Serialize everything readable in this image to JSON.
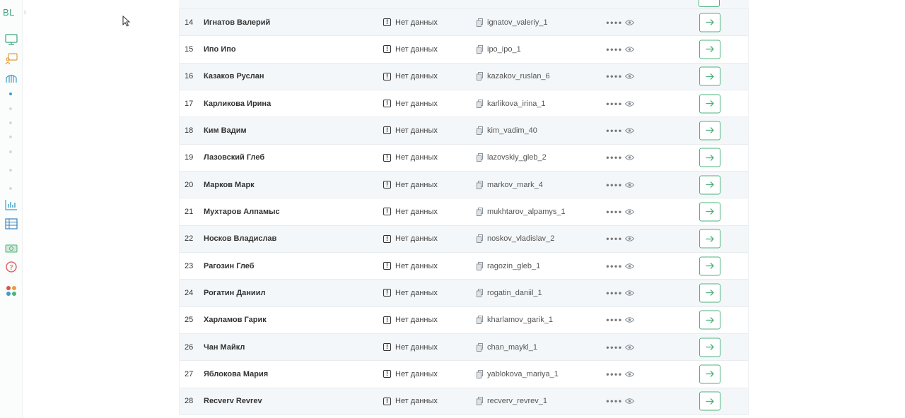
{
  "sidebar": {
    "logo": "BL",
    "icons": [
      "monitor-icon",
      "presentation-icon",
      "structure-icon",
      "chart-icon",
      "table-icon",
      "money-icon",
      "help-icon",
      "apps-icon"
    ],
    "accent": "#3aa57a"
  },
  "table": {
    "status_color": "#333333",
    "rows": [
      {
        "num": "14",
        "name": "Игнатов Валерий",
        "status": "Нет данных",
        "login": "ignatov_valeriy_1",
        "password": "●●●●"
      },
      {
        "num": "15",
        "name": "Ипо Ипо",
        "status": "Нет данных",
        "login": "ipo_ipo_1",
        "password": "●●●●"
      },
      {
        "num": "16",
        "name": "Казаков Руслан",
        "status": "Нет данных",
        "login": "kazakov_ruslan_6",
        "password": "●●●●"
      },
      {
        "num": "17",
        "name": "Карликова Ирина",
        "status": "Нет данных",
        "login": "karlikova_irina_1",
        "password": "●●●●"
      },
      {
        "num": "18",
        "name": "Ким Вадим",
        "status": "Нет данных",
        "login": "kim_vadim_40",
        "password": "●●●●"
      },
      {
        "num": "19",
        "name": "Лазовский Глеб",
        "status": "Нет данных",
        "login": "lazovskiy_gleb_2",
        "password": "●●●●"
      },
      {
        "num": "20",
        "name": "Марков Марк",
        "status": "Нет данных",
        "login": "markov_mark_4",
        "password": "●●●●"
      },
      {
        "num": "21",
        "name": "Мухтаров Алпамыс",
        "status": "Нет данных",
        "login": "mukhtarov_alpamys_1",
        "password": "●●●●"
      },
      {
        "num": "22",
        "name": "Носков Владислав",
        "status": "Нет данных",
        "login": "noskov_vladislav_2",
        "password": "●●●●"
      },
      {
        "num": "23",
        "name": "Рагозин Глеб",
        "status": "Нет данных",
        "login": "ragozin_gleb_1",
        "password": "●●●●"
      },
      {
        "num": "24",
        "name": "Рогатин Даниил",
        "status": "Нет данных",
        "login": "rogatin_daniil_1",
        "password": "●●●●"
      },
      {
        "num": "25",
        "name": "Харламов Гарик",
        "status": "Нет данных",
        "login": "kharlamov_garik_1",
        "password": "●●●●"
      },
      {
        "num": "26",
        "name": "Чан Майкл",
        "status": "Нет данных",
        "login": "chan_maykl_1",
        "password": "●●●●"
      },
      {
        "num": "27",
        "name": "Яблокова Мария",
        "status": "Нет данных",
        "login": "yablokova_mariya_1",
        "password": "●●●●"
      },
      {
        "num": "28",
        "name": "Recverv Revrev",
        "status": "Нет данных",
        "login": "recverv_revrev_1",
        "password": "●●●●"
      }
    ]
  }
}
